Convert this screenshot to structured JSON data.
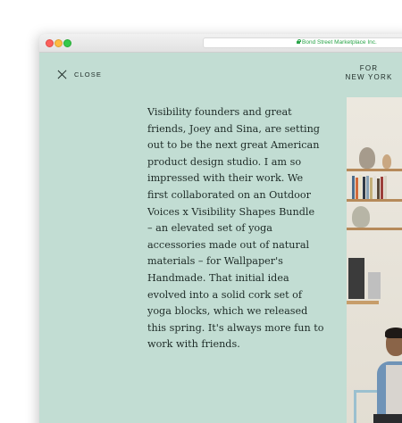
{
  "browser": {
    "url_text": "Bond Street Marketplace Inc."
  },
  "page": {
    "close_label": "CLOSE",
    "for_line1": "FOR",
    "for_line2": "NEW YORK",
    "body_lines": [
      "Visibility founders and great",
      "friends, Joey and Sina, are setting",
      "out to be the next great American",
      "product design studio. I am so",
      "impressed with their work. We",
      "first collaborated on an Outdoor",
      "Voices x Visibility Shapes Bundle",
      "– an elevated set of yoga",
      "accessories made out of natural",
      "materials – for Wallpaper's",
      "Handmade. That initial idea",
      "evolved into a solid cork set of",
      "yoga blocks, which we released",
      "this spring. It's always more fun to",
      "work with friends."
    ]
  },
  "colors": {
    "background": "#c2ddd3",
    "text": "#1e2b27",
    "secure_url": "#2aa449"
  }
}
